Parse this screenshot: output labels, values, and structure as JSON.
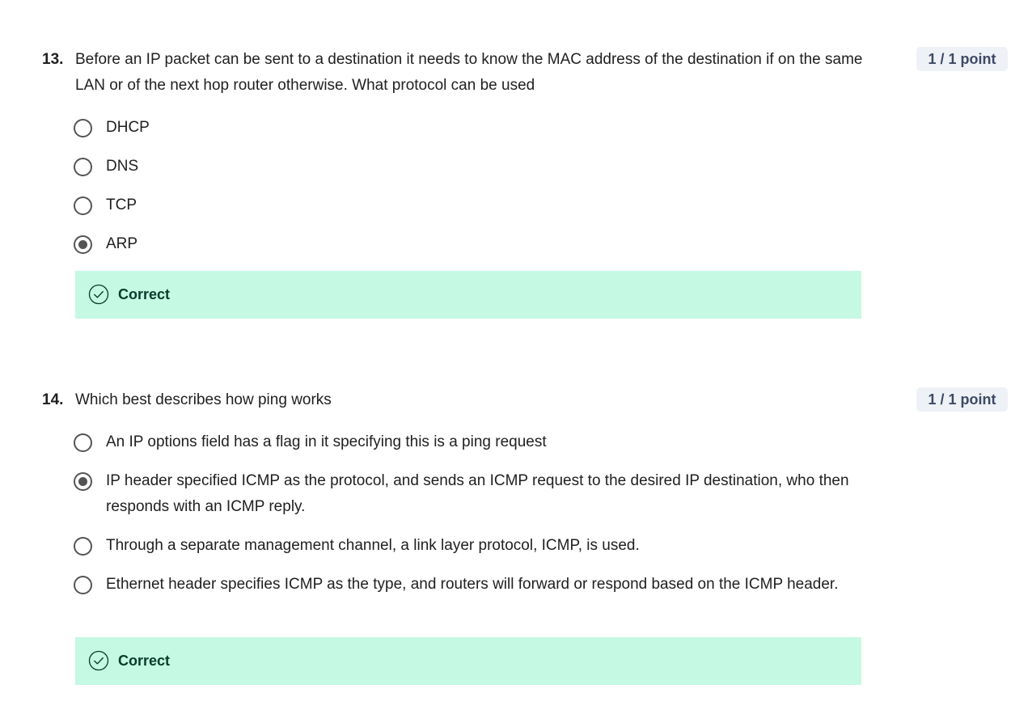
{
  "questions": [
    {
      "number": "13.",
      "text": "Before an IP packet can be sent to a destination it needs to know the MAC address of the destination if on the same LAN or of the next hop router otherwise. What protocol can be used",
      "points": "1 / 1 point",
      "options": [
        {
          "label": "DHCP",
          "selected": false
        },
        {
          "label": "DNS",
          "selected": false
        },
        {
          "label": "TCP",
          "selected": false
        },
        {
          "label": "ARP",
          "selected": true
        }
      ],
      "feedback": "Correct"
    },
    {
      "number": "14.",
      "text": "Which best describes how ping works",
      "points": "1 / 1 point",
      "options": [
        {
          "label": "An IP options field has a flag in it specifying this is a ping request",
          "selected": false
        },
        {
          "label": "IP header specified ICMP as the protocol, and sends an ICMP request to the desired IP destination, who then responds with an ICMP reply.",
          "selected": true
        },
        {
          "label": "Through a separate management channel, a link layer protocol, ICMP, is used.",
          "selected": false
        },
        {
          "label": "Ethernet header specifies ICMP as the type, and routers will forward or respond based on the ICMP header.",
          "selected": false
        }
      ],
      "feedback": "Correct"
    }
  ],
  "icons": {
    "feedback_icon": "check-circle-icon",
    "radio_icon": "radio-button-icon"
  },
  "colors": {
    "feedback_bg": "#c5f9e3",
    "feedback_text": "#0b3b2c",
    "badge_bg": "#eef1f6",
    "badge_text": "#3d4a66",
    "radio": "#545454"
  }
}
